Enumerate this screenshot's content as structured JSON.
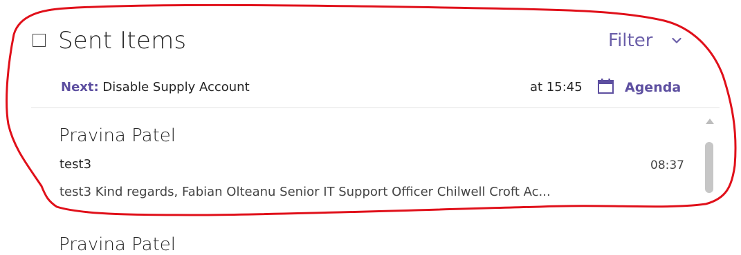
{
  "header": {
    "folder_title": "Sent Items",
    "filter_label": "Filter",
    "filter_chevron_icon": "chevron-down-icon",
    "checkbox_icon": "checkbox-icon"
  },
  "next_event": {
    "label": "Next:",
    "title": "Disable Supply Account",
    "time_text": "at 15:45",
    "calendar_icon": "calendar-icon",
    "agenda_label": "Agenda"
  },
  "messages": [
    {
      "sender": "Pravina Patel",
      "subject": "test3",
      "time": "08:37",
      "preview": "test3   Kind regards,  Fabian Olteanu Senior IT Support Officer Chilwell Croft Ac..."
    },
    {
      "sender": "Pravina Patel"
    }
  ],
  "colors": {
    "accent": "#5d4fa0",
    "filter": "#6b5fa9",
    "annotation": "#e0101a",
    "scroll_thumb": "#c6c6c6"
  }
}
